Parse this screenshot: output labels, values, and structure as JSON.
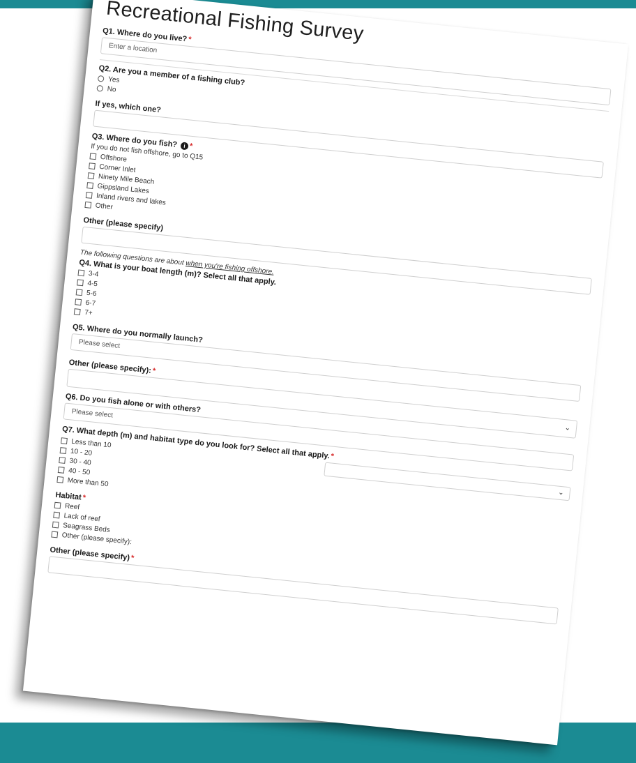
{
  "survey": {
    "title": "Recreational Fishing Survey",
    "q1": {
      "label": "Q1. Where do you live?",
      "required": "*",
      "placeholder": "Enter a location"
    },
    "q2": {
      "label": "Q2. Are you a member of a fishing club?",
      "options": [
        "Yes",
        "No"
      ]
    },
    "q2_followup": {
      "label": "If yes, which one?"
    },
    "q3": {
      "label": "Q3. Where do you fish?",
      "required": "*",
      "note": "If you do not fish offshore, go to Q15",
      "options": [
        "Offshore",
        "Corner Inlet",
        "Ninety Mile Beach",
        "Gippsland Lakes",
        "Inland rivers and lakes",
        "Other"
      ]
    },
    "q3_other": {
      "label": "Other (please specify)"
    },
    "offshore_note": {
      "prefix": "The following questions are about ",
      "emph": "when you're fishing offshore."
    },
    "q4": {
      "label": "Q4. What is your boat length (m)? Select all that apply.",
      "options": [
        "3-4",
        "4-5",
        "5-6",
        "6-7",
        "7+"
      ]
    },
    "q5": {
      "label": "Q5. Where do you normally launch?",
      "placeholder": "Please select"
    },
    "q5_other": {
      "label": "Other (please specify):",
      "required": "*"
    },
    "q6": {
      "label": "Q6. Do you fish alone or with others?",
      "placeholder": "Please select"
    },
    "q7": {
      "label": "Q7. What depth (m) and habitat type do you look for? Select all that apply.",
      "required": "*",
      "options": [
        "Less than 10",
        "10 - 20",
        "30 - 40",
        "40 - 50",
        "More than 50"
      ]
    },
    "habitat": {
      "label": "Habitat",
      "required": "*",
      "options": [
        "Reef",
        "Lack of reef",
        "Seagrass Beds",
        "Other (please specify):"
      ]
    },
    "habitat_other": {
      "label": "Other (please specify)",
      "required": "*"
    }
  }
}
